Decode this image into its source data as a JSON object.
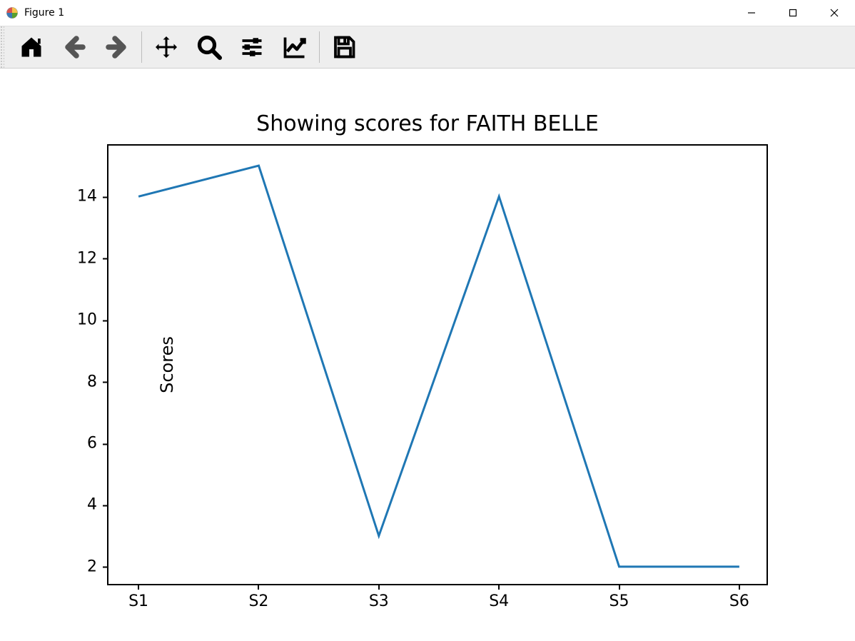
{
  "window": {
    "title": "Figure 1"
  },
  "toolbar": {
    "home": "Home",
    "back": "Back",
    "forward": "Forward",
    "pan": "Pan",
    "zoom": "Zoom",
    "subplots": "Configure subplots",
    "axes": "Edit axes",
    "save": "Save"
  },
  "chart_data": {
    "type": "line",
    "title": "Showing scores for FAITH BELLE",
    "xlabel": "",
    "ylabel": "Scores",
    "categories": [
      "S1",
      "S2",
      "S3",
      "S4",
      "S5",
      "S6"
    ],
    "values": [
      14,
      15,
      3,
      14,
      2,
      2
    ],
    "yticks": [
      2,
      4,
      6,
      8,
      10,
      12,
      14
    ],
    "ylim": [
      1.35,
      15.65
    ],
    "line_color": "#1f77b4"
  }
}
